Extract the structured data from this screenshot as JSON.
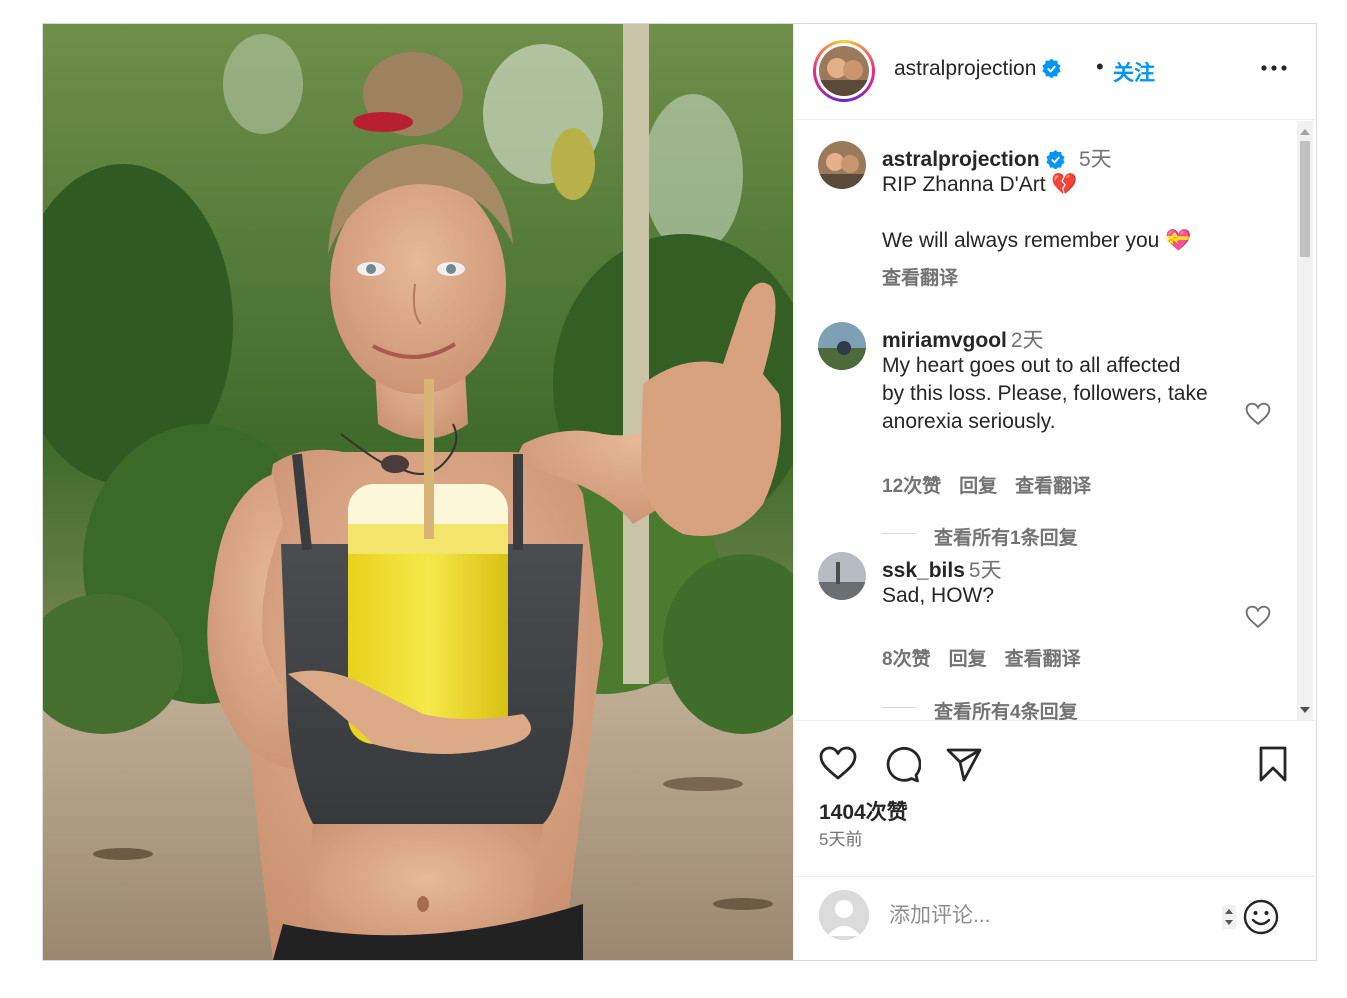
{
  "header": {
    "username": "astralprojection",
    "dot": "•",
    "follow_label": "关注"
  },
  "caption": {
    "username": "astralprojection",
    "time": "5天",
    "line1": "RIP Zhanna D'Art 💔",
    "line2": "We will always remember you 💝",
    "translate": "查看翻译"
  },
  "comments": [
    {
      "username": "miriamvgool",
      "time": "2天",
      "lines": [
        "My heart goes out to all affected",
        "by this loss. Please, followers, take",
        "anorexia seriously."
      ],
      "likes": "12次赞",
      "reply": "回复",
      "translate": "查看翻译",
      "view_replies": "查看所有1条回复"
    },
    {
      "username": "ssk_bils",
      "time": "5天",
      "lines": [
        "Sad, HOW?"
      ],
      "likes": "8次赞",
      "reply": "回复",
      "translate": "查看翻译",
      "view_replies": "查看所有4条回复"
    }
  ],
  "post": {
    "likes": "1404次赞",
    "ago": "5天前"
  },
  "add_comment": {
    "placeholder": "添加评论..."
  },
  "colors": {
    "accent": "#0095f6",
    "verified": "#0095f6",
    "text": "#262626",
    "secondary": "#737373"
  },
  "icons": [
    "more-icon",
    "heart-icon",
    "comment-icon",
    "share-icon",
    "save-icon",
    "emoji-icon",
    "verified-icon"
  ]
}
